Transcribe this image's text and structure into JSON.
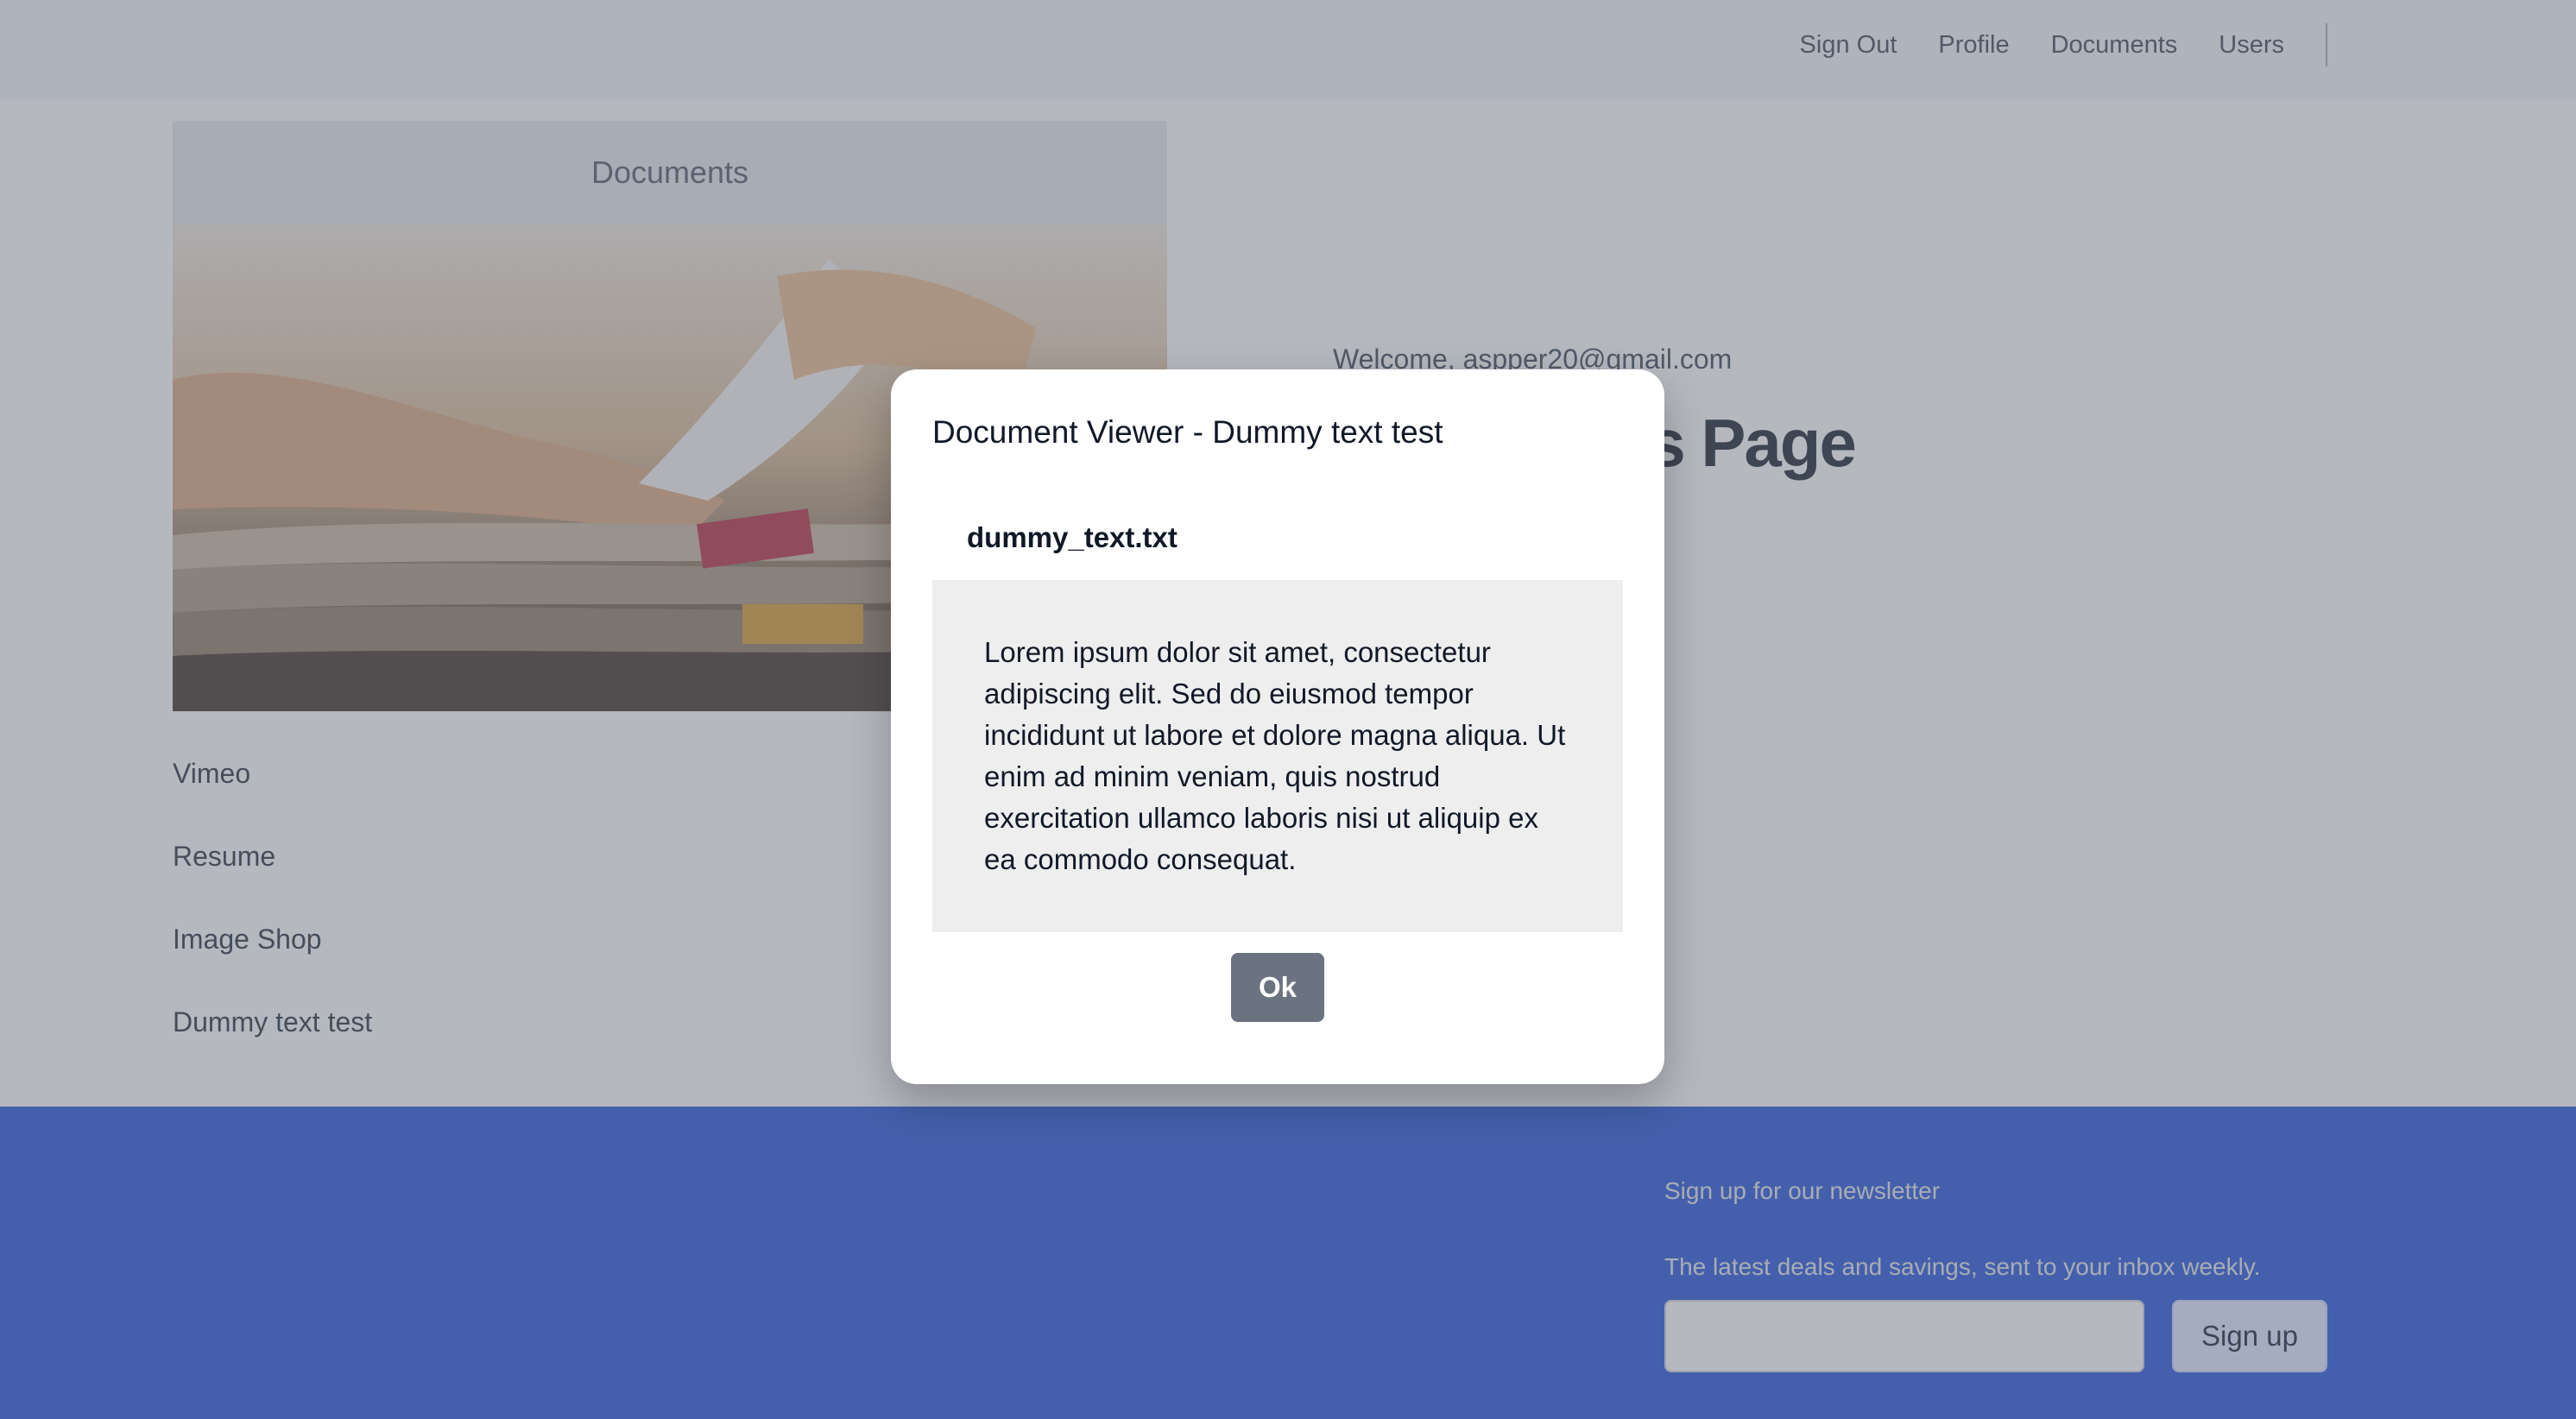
{
  "nav": {
    "items": [
      "Sign Out",
      "Profile",
      "Documents",
      "Users"
    ]
  },
  "card": {
    "header": "Documents"
  },
  "documents": [
    "Vimeo",
    "Resume",
    "Image Shop",
    "Dummy text test"
  ],
  "main": {
    "welcome": "Welcome, aspper20@gmail.com",
    "heading": "Documents Page"
  },
  "footer": {
    "newsletter_title": "Sign up for our newsletter",
    "newsletter_desc": "The latest deals and savings, sent to your inbox weekly.",
    "email_value": "",
    "signup_label": "Sign up"
  },
  "modal": {
    "title": "Document Viewer - Dummy text test",
    "file_name": "dummy_text.txt",
    "content": "Lorem ipsum dolor sit amet, consectetur adipiscing elit. Sed do eiusmod tempor incididunt ut labore et dolore magna aliqua. Ut enim ad minim veniam, quis nostrud exercitation ullamco laboris nisi ut aliquip ex ea commodo consequat.",
    "ok_label": "Ok"
  },
  "colors": {
    "footer_bg": "#1d4ed8",
    "ok_button": "#6b7280"
  },
  "icons": {
    "hero_image": "stack-of-papers-photo"
  }
}
